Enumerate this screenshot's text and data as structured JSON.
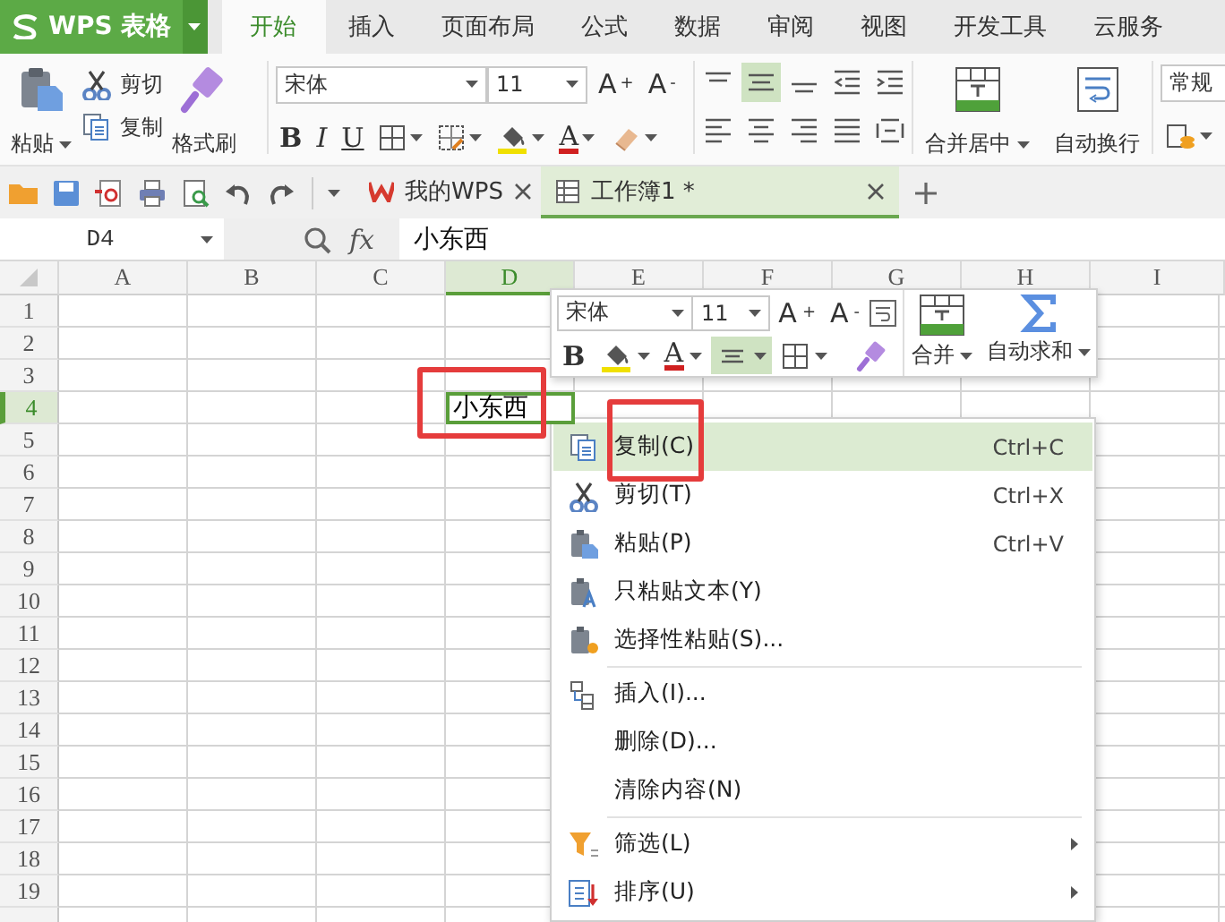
{
  "app": {
    "name": "WPS 表格"
  },
  "menu_tabs": [
    {
      "label": "开始",
      "selected": true
    },
    {
      "label": "插入",
      "selected": false
    },
    {
      "label": "页面布局",
      "selected": false
    },
    {
      "label": "公式",
      "selected": false
    },
    {
      "label": "数据",
      "selected": false
    },
    {
      "label": "审阅",
      "selected": false
    },
    {
      "label": "视图",
      "selected": false
    },
    {
      "label": "开发工具",
      "selected": false
    },
    {
      "label": "云服务",
      "selected": false
    }
  ],
  "ribbon": {
    "paste": "粘贴",
    "cut": "剪切",
    "copy": "复制",
    "format_painter": "格式刷",
    "font_name": "宋体",
    "font_size": "11",
    "grow_font": "A$^{+}$",
    "shrink_font": "A$^{-}$",
    "bold": "B",
    "italic": "I",
    "underline": "U",
    "font_color": "A",
    "align_buttons": [
      {
        "kind": "top",
        "selected": false
      },
      {
        "kind": "middle",
        "selected": true
      },
      {
        "kind": "bottom",
        "selected": false
      },
      {
        "kind": "outdent",
        "selected": false
      },
      {
        "kind": "indent",
        "selected": false
      },
      {
        "kind": "left",
        "selected": false
      },
      {
        "kind": "center",
        "selected": false
      },
      {
        "kind": "right",
        "selected": false
      },
      {
        "kind": "justify",
        "selected": false
      },
      {
        "kind": "distributed",
        "selected": false
      }
    ],
    "merge_center": "合并居中",
    "wrap_text": "自动换行",
    "number_format": "常规"
  },
  "doc_tabs": [
    {
      "kind": "home",
      "label": "我的WPS",
      "selected": false
    },
    {
      "kind": "workbook",
      "label": "工作簿1 *",
      "selected": true
    }
  ],
  "formula_bar": {
    "cell_ref": "D4",
    "fx": "fx",
    "value": "小东西"
  },
  "sheet": {
    "columns": [
      {
        "label": "A",
        "selected": false
      },
      {
        "label": "B",
        "selected": false
      },
      {
        "label": "C",
        "selected": false
      },
      {
        "label": "D",
        "selected": true
      },
      {
        "label": "E",
        "selected": false
      },
      {
        "label": "F",
        "selected": false
      },
      {
        "label": "G",
        "selected": false
      },
      {
        "label": "H",
        "selected": false
      },
      {
        "label": "I",
        "selected": false
      }
    ],
    "rows": [
      {
        "label": "1",
        "selected": false
      },
      {
        "label": "2",
        "selected": false
      },
      {
        "label": "3",
        "selected": false
      },
      {
        "label": "4",
        "selected": true
      },
      {
        "label": "5",
        "selected": false
      },
      {
        "label": "6",
        "selected": false
      },
      {
        "label": "7",
        "selected": false
      },
      {
        "label": "8",
        "selected": false
      },
      {
        "label": "9",
        "selected": false
      },
      {
        "label": "10",
        "selected": false
      },
      {
        "label": "11",
        "selected": false
      },
      {
        "label": "12",
        "selected": false
      },
      {
        "label": "13",
        "selected": false
      },
      {
        "label": "14",
        "selected": false
      },
      {
        "label": "15",
        "selected": false
      },
      {
        "label": "16",
        "selected": false
      },
      {
        "label": "17",
        "selected": false
      },
      {
        "label": "18",
        "selected": false
      },
      {
        "label": "19",
        "selected": false
      }
    ],
    "active_cell": {
      "value": "小东西",
      "highlighted": true
    }
  },
  "mini_toolbar": {
    "font_name": "宋体",
    "font_size": "11",
    "grow_font": "A$^{+}$",
    "shrink_font": "A$^{-}$",
    "bold": "B",
    "font_color": "A",
    "align_selected": true,
    "merge": "合并",
    "autosum": "自动求和"
  },
  "context_menu": [
    {
      "kind": "copy",
      "label": "复制(C)",
      "shortcut": "Ctrl+C",
      "selected": true,
      "highlighted": true
    },
    {
      "kind": "cut",
      "label": "剪切(T)",
      "shortcut": "Ctrl+X",
      "selected": false,
      "highlighted": false
    },
    {
      "kind": "paste",
      "label": "粘贴(P)",
      "shortcut": "Ctrl+V",
      "selected": false,
      "highlighted": false
    },
    {
      "kind": "paste-text",
      "label": "只粘贴文本(Y)",
      "selected": false,
      "highlighted": false
    },
    {
      "kind": "paste-special",
      "label": "选择性粘贴(S)...",
      "selected": false,
      "highlighted": false
    },
    {
      "kind": "separator"
    },
    {
      "kind": "insert",
      "label": "插入(I)...",
      "selected": false,
      "highlighted": false
    },
    {
      "kind": "plain",
      "label": "删除(D)...",
      "selected": false,
      "highlighted": false
    },
    {
      "kind": "plain",
      "label": "清除内容(N)",
      "selected": false,
      "highlighted": false
    },
    {
      "kind": "separator"
    },
    {
      "kind": "filter",
      "label": "筛选(L)",
      "selected": false,
      "highlighted": false,
      "submenu": true
    },
    {
      "kind": "sort",
      "label": "排序(U)",
      "selected": false,
      "highlighted": false,
      "submenu": true
    }
  ]
}
